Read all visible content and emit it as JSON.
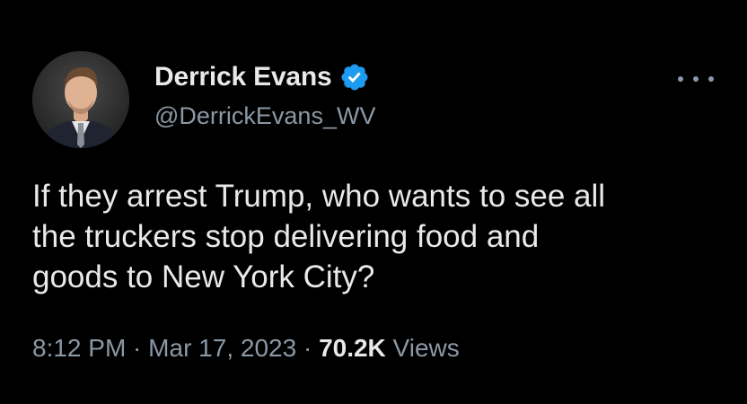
{
  "user": {
    "display_name": "Derrick Evans",
    "handle": "@DerrickEvans_WV",
    "verified": true
  },
  "tweet": {
    "text": "If they arrest Trump, who wants to see all\nthe truckers stop delivering food and\ngoods to New York City?",
    "time": "8:12 PM",
    "separator": " · ",
    "date": "Mar 17, 2023",
    "views_count": "70.2K",
    "views_label": " Views"
  },
  "icons": {
    "verified": "verified-badge-icon",
    "more": "more-options-icon"
  },
  "colors": {
    "background": "#000000",
    "primary_text": "#e7e9ea",
    "secondary_text": "#8b98a5",
    "verified_blue": "#1d9bf0"
  }
}
